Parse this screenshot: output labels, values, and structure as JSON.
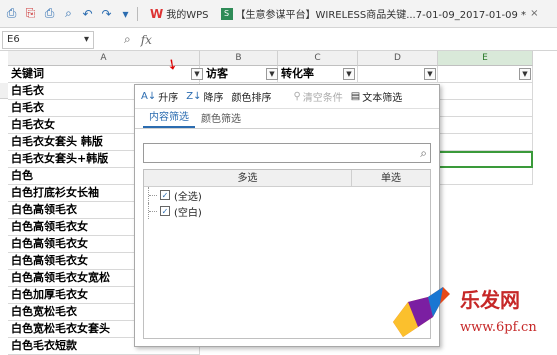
{
  "toolbar": {
    "wps_tab": "我的WPS",
    "doc_tab": "【生意参谋平台】WIRELESS商品关键...7-01-09_2017-01-09 *",
    "tab_close": "×"
  },
  "formula_bar": {
    "name_box": "E6",
    "fx": "fx"
  },
  "columns": [
    {
      "label": "A"
    },
    {
      "label": "B"
    },
    {
      "label": "C"
    },
    {
      "label": "D"
    },
    {
      "label": "E"
    }
  ],
  "header_row": {
    "a": "关键词",
    "b": "访客",
    "c": "转化率"
  },
  "rows": [
    "白毛衣",
    "白毛衣",
    "白毛衣女",
    "白毛衣女套头 韩版",
    "白毛衣女套头+韩版",
    "白色",
    "白色打底衫女长袖",
    "白色高领毛衣",
    "白色高领毛衣女",
    "白色高领毛衣女",
    "白色高领毛衣女",
    "白色高领毛衣女宽松",
    "白色加厚毛衣女",
    "白色宽松毛衣",
    "白色宽松毛衣女套头",
    "白色毛衣短款"
  ],
  "filter_popup": {
    "sort_asc": "升序",
    "sort_desc": "降序",
    "color_sort": "颜色排序",
    "clear": "清空条件",
    "text_filter": "文本筛选",
    "tab_content": "内容筛选",
    "tab_color": "颜色筛选",
    "search_placeholder": "",
    "col_multi": "多选",
    "col_single": "单选",
    "items": [
      {
        "label": "(全选)",
        "checked": true
      },
      {
        "label": "(空白)",
        "checked": true
      }
    ]
  },
  "watermark": {
    "title": "乐发网",
    "url": "www.6pf.cn"
  }
}
